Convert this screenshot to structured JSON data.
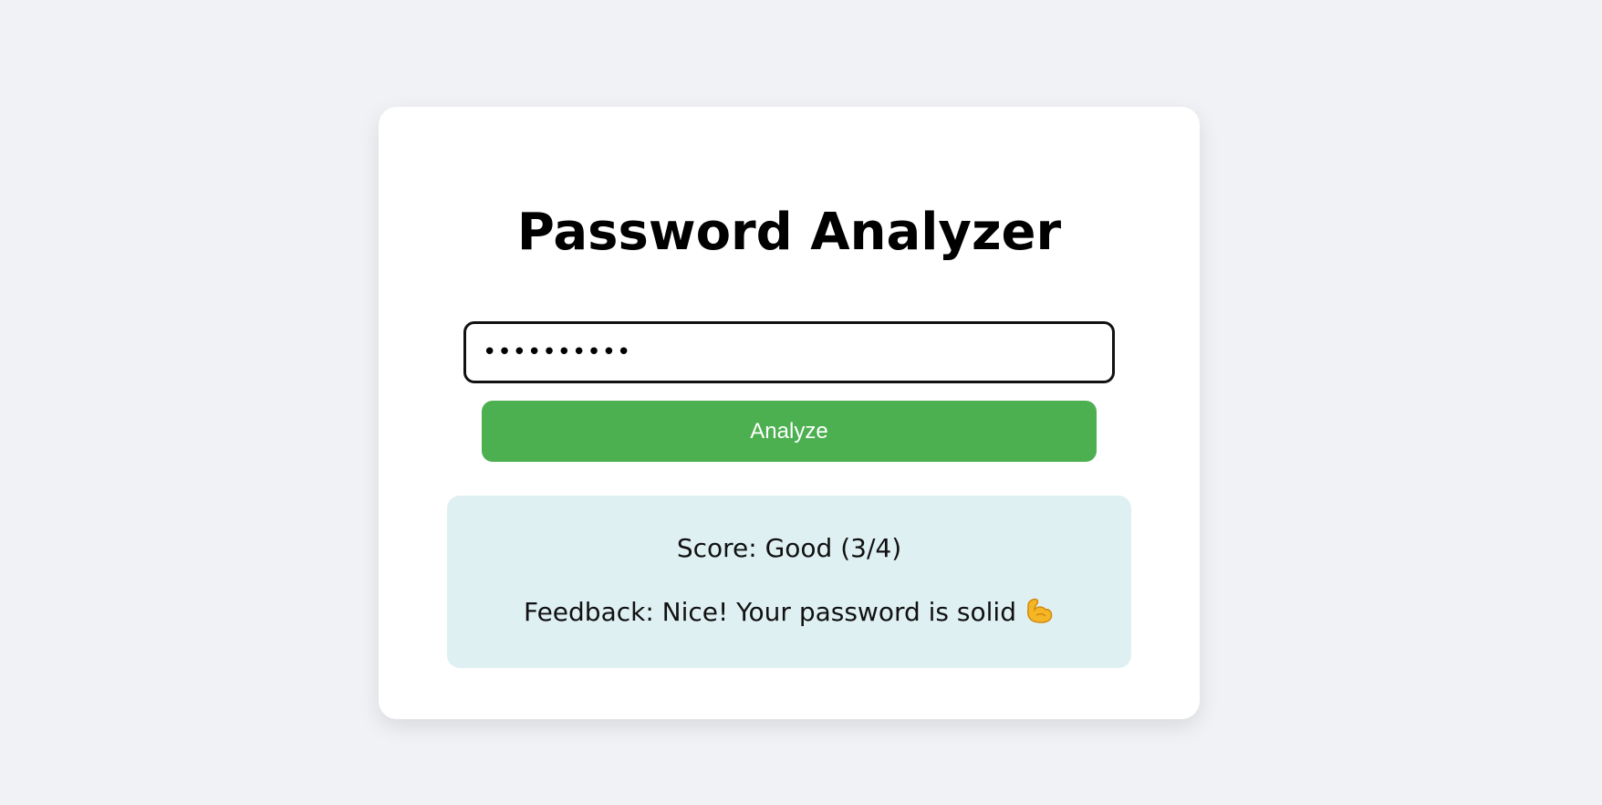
{
  "app": {
    "title": "Password Analyzer"
  },
  "password_input": {
    "value": "••••••••••",
    "type": "password"
  },
  "analyze_button": {
    "label": "Analyze"
  },
  "result": {
    "score": "Score: Good (3/4)",
    "feedback": "Feedback: Nice! Your password is solid",
    "feedback_icon": "flexed-biceps-icon"
  },
  "colors": {
    "background": "#f0f2f5",
    "card": "#ffffff",
    "button": "#4caf50",
    "result_box": "#dff0f3",
    "muscle_icon": "#f5b625"
  }
}
